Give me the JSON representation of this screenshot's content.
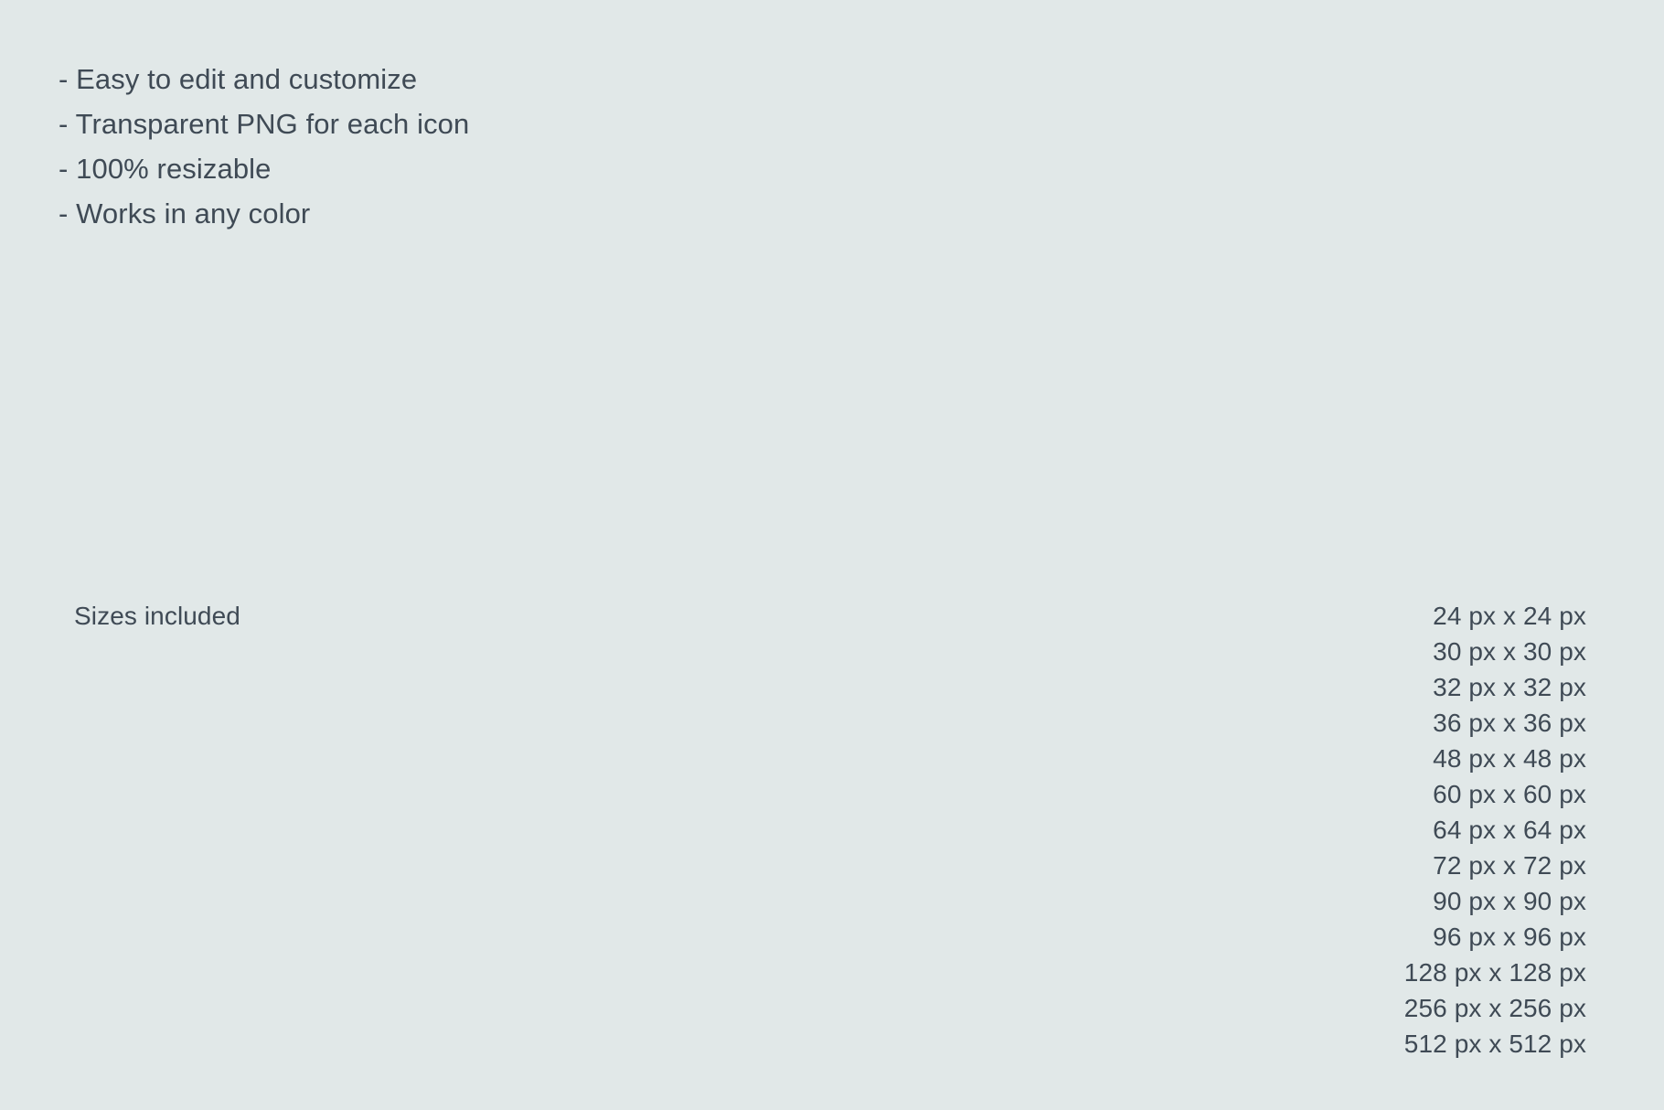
{
  "theme": {
    "background_color": "#e1e8e8",
    "text_color": "#3f4a55"
  },
  "features": {
    "items": [
      {
        "text": "- Easy to edit and customize"
      },
      {
        "text": "- Transparent PNG for each icon"
      },
      {
        "text": "- 100% resizable"
      },
      {
        "text": "- Works in any color"
      }
    ]
  },
  "sizes": {
    "label": "Sizes included",
    "items": [
      {
        "text": "24 px x 24 px"
      },
      {
        "text": "30 px x 30 px"
      },
      {
        "text": "32 px x 32 px"
      },
      {
        "text": "36 px x 36 px"
      },
      {
        "text": "48 px x 48 px"
      },
      {
        "text": "60 px x 60 px"
      },
      {
        "text": "64 px x 64 px"
      },
      {
        "text": "72 px x 72 px"
      },
      {
        "text": "90 px x 90 px"
      },
      {
        "text": "96 px x 96 px"
      },
      {
        "text": "128 px x 128 px"
      },
      {
        "text": "256 px x 256 px"
      },
      {
        "text": "512 px x 512 px"
      }
    ]
  }
}
